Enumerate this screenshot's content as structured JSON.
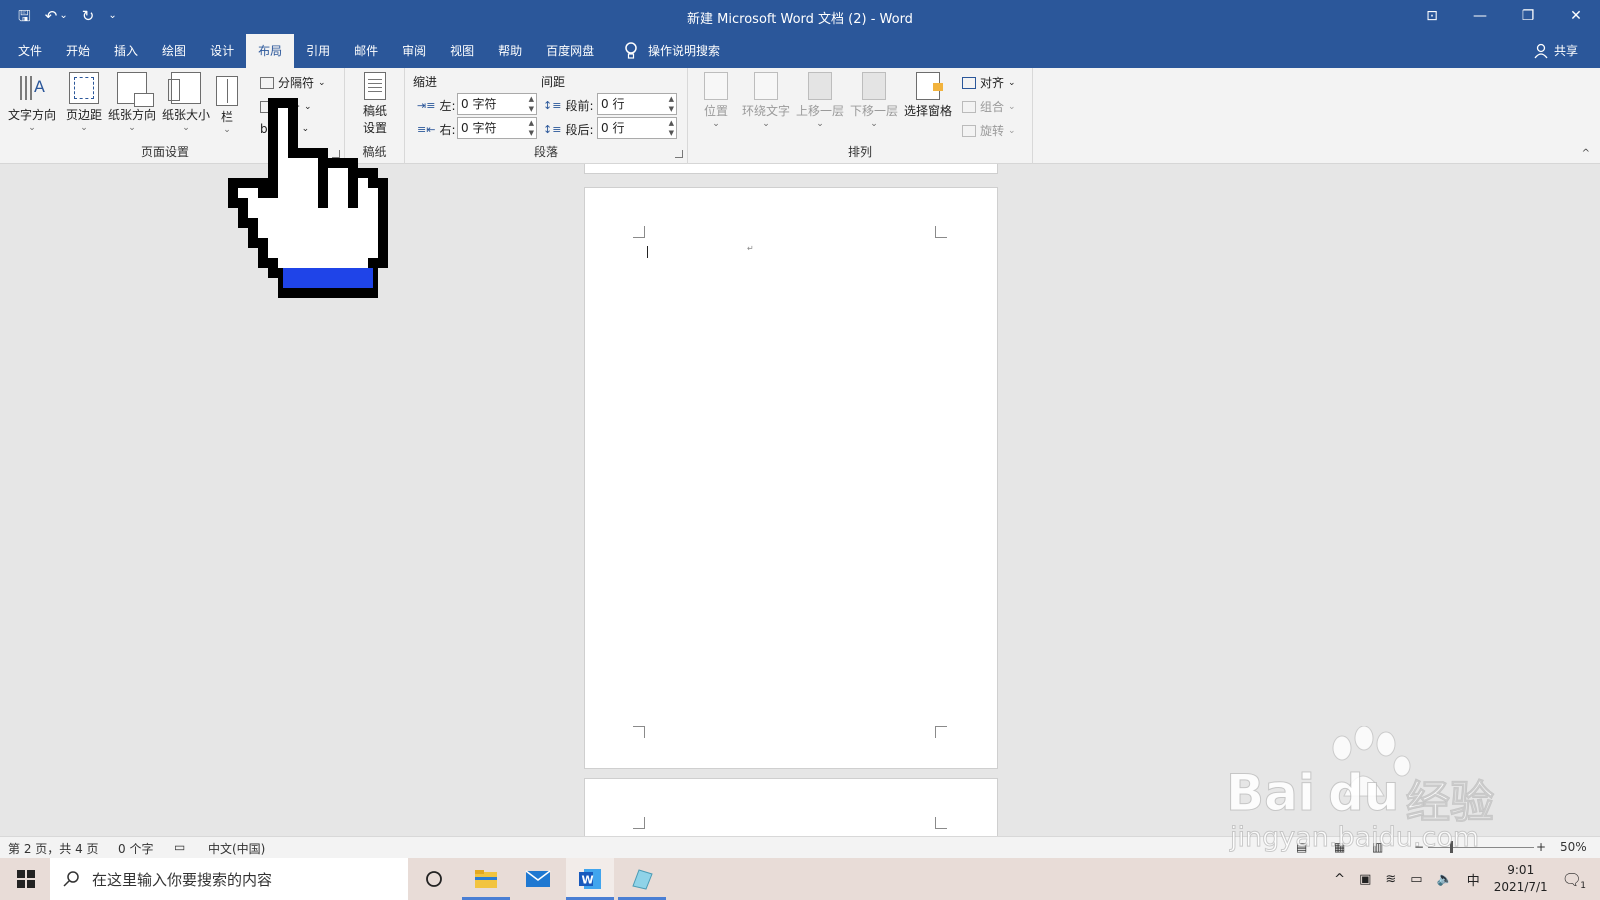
{
  "window": {
    "title": "新建 Microsoft Word 文档 (2)  -  Word",
    "controls": [
      "⊡",
      "—",
      "❐",
      "✕"
    ]
  },
  "qat": {
    "save": "🖫",
    "undo": "↶",
    "undo_caret": "⌄",
    "redo": "↻",
    "customize": "⌄"
  },
  "menu": {
    "tabs": [
      "文件",
      "开始",
      "插入",
      "绘图",
      "设计",
      "布局",
      "引用",
      "邮件",
      "审阅",
      "视图",
      "帮助",
      "百度网盘"
    ],
    "active_tab": "布局",
    "tell_me": "操作说明搜索",
    "share": "共享"
  },
  "ribbon": {
    "page_setup": {
      "label": "页面设置",
      "text_direction": "文字方向",
      "margins": "页边距",
      "orientation": "纸张方向",
      "size": "纸张大小",
      "columns": "栏",
      "breaks": "分隔符",
      "line_numbers_partial": "号",
      "hyphenation_partial": "b"
    },
    "draft_paper": {
      "label": "稿纸",
      "setup_line1": "稿纸",
      "setup_line2": "设置"
    },
    "paragraph": {
      "label": "段落",
      "indent_title": "缩进",
      "spacing_title": "间距",
      "left_label": "左:",
      "right_label": "右:",
      "left_value": "0 字符",
      "right_value": "0 字符",
      "before_label": "段前:",
      "after_label": "段后:",
      "before_value": "0 行",
      "after_value": "0 行"
    },
    "arrange": {
      "label": "排列",
      "position": "位置",
      "wrap_text": "环绕文字",
      "bring_forward": "上移一层",
      "send_backward": "下移一层",
      "selection_pane": "选择窗格",
      "align": "对齐",
      "group": "组合",
      "rotate": "旋转"
    }
  },
  "status": {
    "page": "第 2 页，共 4 页",
    "words": "0 个字",
    "language": "中文(中国)",
    "zoom": "50%",
    "zoom_minus": "−",
    "zoom_plus": "+"
  },
  "taskbar": {
    "search_placeholder": "在这里输入你要搜索的内容",
    "time": "9:01",
    "date": "2021/7/1",
    "ime": "中",
    "notification_count": "1"
  },
  "watermark": {
    "brand": "Bai",
    "brand2": "du",
    "cn": "经验",
    "url": "jingyan.baidu.com"
  },
  "colors": {
    "word_blue": "#2b579a",
    "ribbon_bg": "#f3f3f3",
    "canvas_bg": "#e6e6e6",
    "taskbar_bg": "#e8dcd7"
  }
}
